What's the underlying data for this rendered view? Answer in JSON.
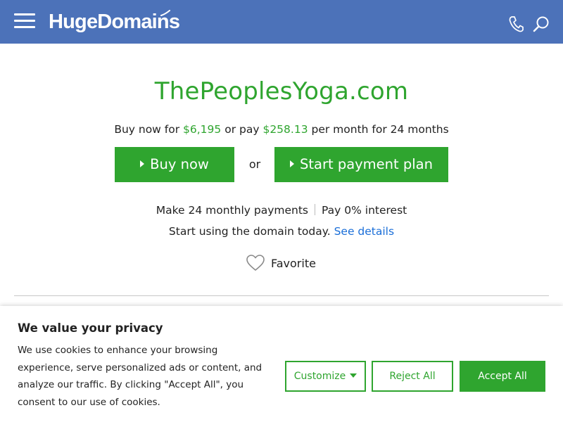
{
  "header": {
    "logo_text": "HugeDomains",
    "menu_icon": "hamburger-menu-icon",
    "phone_icon": "phone-icon",
    "search_icon": "search-icon",
    "bg_color": "#4c72b9"
  },
  "listing": {
    "domain": "ThePeoplesYoga.com",
    "price_prefix": "Buy now for",
    "price": "$6,195",
    "price_middle": "or pay",
    "monthly_price": "$258.13",
    "price_suffix": "per month for 24 months",
    "buy_label": "Buy now",
    "or_label": "or",
    "plan_label": "Start payment plan",
    "feature_1": "Make 24 monthly payments",
    "feature_2": "Pay 0% interest",
    "details_text": "Start using the domain today.",
    "details_link": "See details",
    "favorite_label": "Favorite",
    "accent_color": "#2fa52f",
    "link_color": "#1a6ed8"
  },
  "cookie": {
    "title": "We value your privacy",
    "text": "We use cookies to enhance your browsing experience, serve personalized ads or content, and analyze our traffic. By clicking \"Accept All\", you consent to our use of cookies.",
    "customize_label": "Customize",
    "reject_label": "Reject All",
    "accept_label": "Accept All"
  }
}
